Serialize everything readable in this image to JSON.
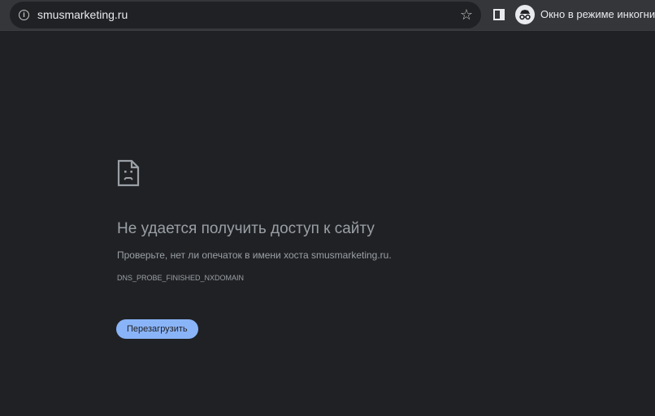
{
  "browser": {
    "url": "smusmarketing.ru",
    "incognito_label": "Окно в режиме инкогнито",
    "icons": {
      "site_info": "info-icon",
      "bookmark": "star-icon",
      "side_panel": "side-panel-icon",
      "incognito": "incognito-icon"
    }
  },
  "error_page": {
    "icon": "sad-page-icon",
    "title": "Не удается получить доступ к сайту",
    "description": "Проверьте, нет ли опечаток в имени хоста smusmarketing.ru.",
    "error_code": "DNS_PROBE_FINISHED_NXDOMAIN",
    "reload_label": "Перезагрузить"
  },
  "colors": {
    "background": "#202124",
    "toolbar": "#35363a",
    "text_secondary": "#9aa0a6",
    "accent": "#8ab4f8"
  }
}
